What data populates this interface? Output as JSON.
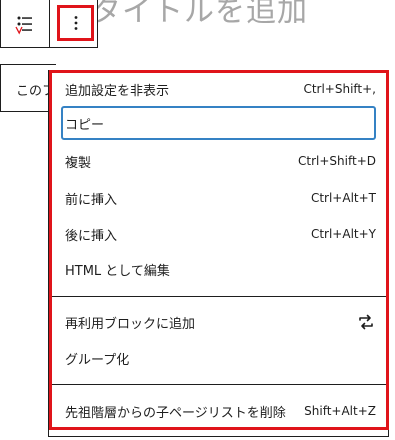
{
  "background": {
    "title_fragment": "ンタイトルを追加"
  },
  "toolbar": {
    "block_icon": "list-pages-icon",
    "options_icon": "vertical-ellipsis-icon"
  },
  "underlying_block": {
    "text": "このフ"
  },
  "menu": {
    "groups": [
      [
        {
          "label": "追加設定を非表示",
          "shortcut": "Ctrl+Shift+,"
        },
        {
          "label": "コピー",
          "shortcut": ""
        },
        {
          "label": "複製",
          "shortcut": "Ctrl+Shift+D"
        },
        {
          "label": "前に挿入",
          "shortcut": "Ctrl+Alt+T"
        },
        {
          "label": "後に挿入",
          "shortcut": "Ctrl+Alt+Y"
        },
        {
          "label": "HTML として編集",
          "shortcut": ""
        }
      ],
      [
        {
          "label": "再利用ブロックに追加",
          "icon": "reusable-block-icon"
        },
        {
          "label": "グループ化",
          "shortcut": ""
        }
      ],
      [
        {
          "label": "先祖階層からの子ページリストを削除",
          "shortcut": "Shift+Alt+Z"
        }
      ]
    ]
  },
  "colors": {
    "highlight": "#e0141a",
    "focus": "#3582c4",
    "border": "#1e1e1e"
  }
}
